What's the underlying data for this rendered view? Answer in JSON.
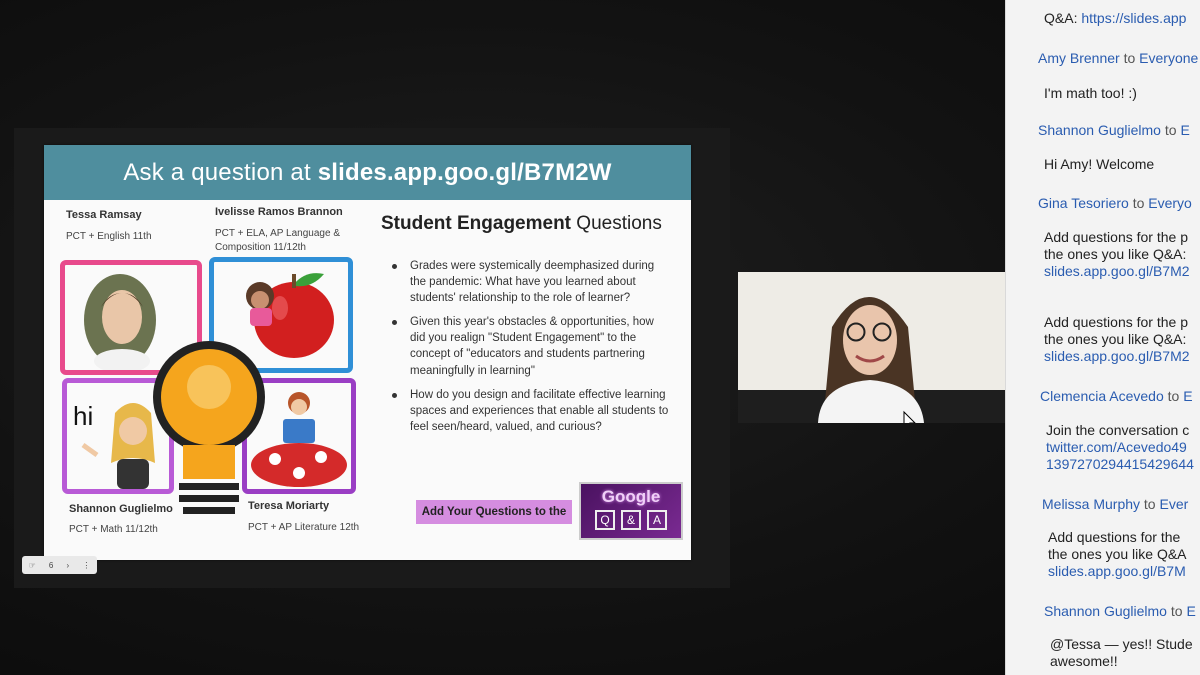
{
  "slide": {
    "header_prefix": "Ask a question at ",
    "header_link": "slides.app.goo.gl/B7M2W",
    "presenters": [
      {
        "name": "Tessa Ramsay",
        "role": "PCT + English 11th"
      },
      {
        "name": "Ivelisse Ramos Brannon",
        "role_line1": "PCT + ELA, AP Language &",
        "role_line2": "Composition 11/12th"
      },
      {
        "name": "Shannon Guglielmo",
        "role": "PCT + Math 11/12th"
      },
      {
        "name": "Teresa Moriarty",
        "role": "PCT + AP Literature 12th"
      }
    ],
    "hi_text": "hi",
    "engagement_title_bold": "Student Engagement",
    "engagement_title_rest": " Questions",
    "bullets": [
      "Grades were systemically deemphasized during the pandemic: What have you learned about students' relationship to the role of learner?",
      "Given this year's obstacles & opportunities, how did you realign \"Student Engagement\" to the concept of \"educators and students partnering meaningfully in learning\"",
      "How do you design and facilitate effective learning spaces and experiences that enable all students to feel seen/heard, valued, and curious?"
    ],
    "add_questions_label": "Add Your Questions to the",
    "logo_word": "Google",
    "logo_qa": [
      "Q",
      "&",
      "A"
    ]
  },
  "toolbar": {
    "page_number": "6",
    "next_symbol": "›",
    "more_symbol": "⋮"
  },
  "chat": {
    "top_prefix": "Q&A: ",
    "top_link": "https://slides.app",
    "to_word": "to",
    "messages": [
      {
        "sender": "Amy Brenner",
        "recipient": "Everyone",
        "lines": [
          "I'm math too! :)"
        ]
      },
      {
        "sender": "Shannon Guglielmo",
        "recipient": "E",
        "lines": [
          "Hi Amy! Welcome"
        ]
      },
      {
        "sender": "Gina Tesoriero",
        "recipient": "Everyo",
        "lines": [
          "Add questions for the p",
          "the ones you like Q&A:"
        ],
        "link": "slides.app.goo.gl/B7M2"
      },
      {
        "sender": "",
        "recipient": "",
        "lines": [
          "Add questions for the p",
          "the ones you like Q&A:"
        ],
        "link": "slides.app.goo.gl/B7M2"
      },
      {
        "sender": "Clemencia Acevedo",
        "recipient": "E",
        "lines": [
          "Join the conversation c"
        ],
        "link": "twitter.com/Acevedo49",
        "link2": "1397270294415429644"
      },
      {
        "sender": "Melissa Murphy",
        "recipient": "Ever",
        "lines": [
          "Add questions for the",
          "the ones you like Q&A"
        ],
        "link": "slides.app.goo.gl/B7M"
      },
      {
        "sender": "Shannon Guglielmo",
        "recipient": "E",
        "lines": [
          "@Tessa — yes!! Stude",
          "awesome!!"
        ]
      }
    ]
  },
  "colors": {
    "slide_header": "#4f8e9e",
    "chat_sender": "#2a5cb0",
    "add_button": "#d58de0",
    "frame_pink": "#e84a8c",
    "frame_blue": "#2f8fd6",
    "frame_purple": "#b85ad6"
  }
}
